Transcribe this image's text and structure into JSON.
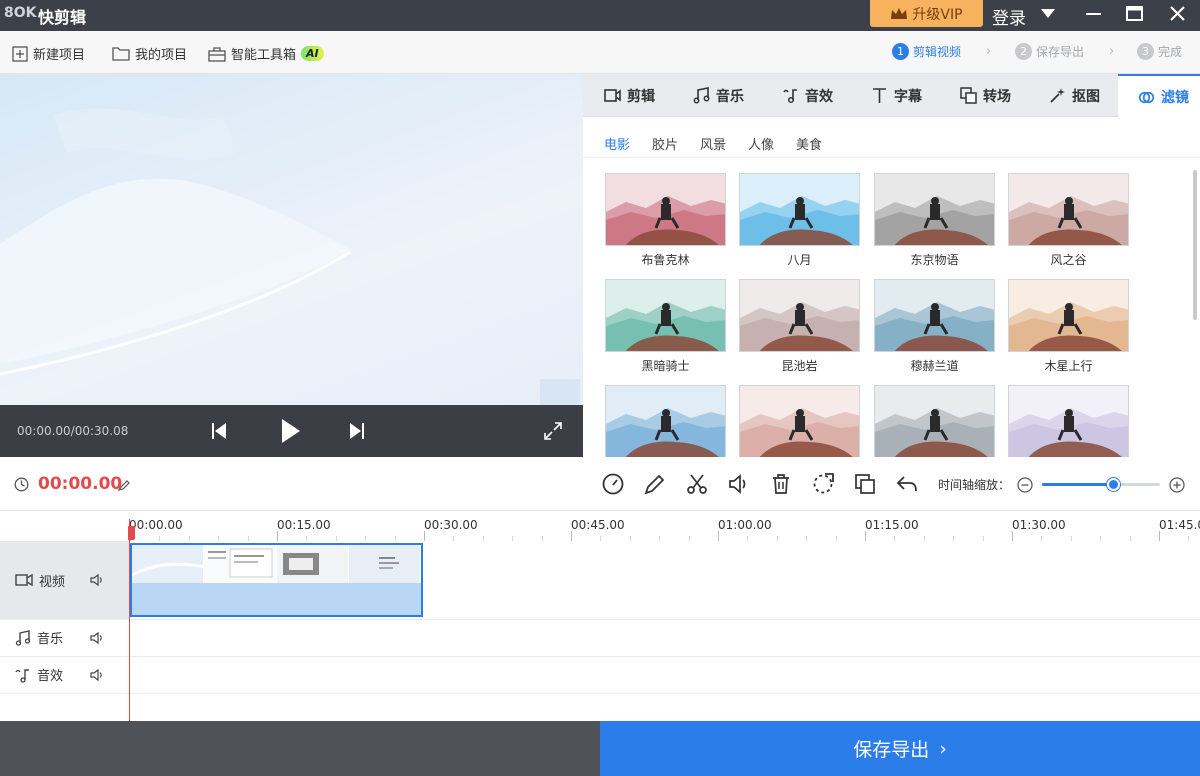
{
  "title_bar": {
    "logo": "8OK",
    "app_name": "快剪辑",
    "vip_label": "升级VIP",
    "login_label": "登录"
  },
  "toolbar": {
    "new_project": "新建项目",
    "my_projects": "我的项目",
    "smart_tools": "智能工具箱",
    "ai_badge": "AI"
  },
  "steps": [
    {
      "num": "1",
      "label": "剪辑视频",
      "active": true
    },
    {
      "num": "2",
      "label": "保存导出",
      "active": false
    },
    {
      "num": "3",
      "label": "完成",
      "active": false
    }
  ],
  "player": {
    "time_readout": "00:00.00/00:30.08"
  },
  "tabs": [
    {
      "label": "剪辑",
      "icon": "video-icon"
    },
    {
      "label": "音乐",
      "icon": "music-icon"
    },
    {
      "label": "音效",
      "icon": "sound-effect-icon"
    },
    {
      "label": "字幕",
      "icon": "text-icon"
    },
    {
      "label": "转场",
      "icon": "transition-icon"
    },
    {
      "label": "抠图",
      "icon": "magic-wand-icon"
    },
    {
      "label": "滤镜",
      "icon": "filter-icon",
      "active": true
    }
  ],
  "filter_categories": [
    {
      "label": "电影",
      "active": true
    },
    {
      "label": "胶片"
    },
    {
      "label": "风景"
    },
    {
      "label": "人像"
    },
    {
      "label": "美食"
    }
  ],
  "filters": [
    {
      "label": "布鲁克林",
      "tint": "#c96a7a"
    },
    {
      "label": "八月",
      "tint": "#5fb8e8"
    },
    {
      "label": "东京物语",
      "tint": "#9a9a9a"
    },
    {
      "label": "风之谷",
      "tint": "#c8a09a"
    },
    {
      "label": "黑暗骑士",
      "tint": "#6ab8a8"
    },
    {
      "label": "昆池岩",
      "tint": "#c0a8a8"
    },
    {
      "label": "穆赫兰道",
      "tint": "#7aa8c0"
    },
    {
      "label": "木星上行",
      "tint": "#e0b088"
    },
    {
      "label": "",
      "tint": "#7ab0d8"
    },
    {
      "label": "",
      "tint": "#d8a8a0"
    },
    {
      "label": "",
      "tint": "#a0a8b0"
    },
    {
      "label": "",
      "tint": "#c8c0e0"
    }
  ],
  "timeline": {
    "current_time": "00:00.00",
    "zoom_label": "时间轴缩放：",
    "zoom_level": 0.6,
    "ruler_labels": [
      "00:00.00",
      "00:15.00",
      "00:30.00",
      "00:45.00",
      "01:00.00",
      "01:15.00",
      "01:30.00",
      "01:45.00"
    ],
    "tracks": [
      {
        "label": "视频",
        "icon": "video-icon"
      },
      {
        "label": "音乐",
        "icon": "music-icon"
      },
      {
        "label": "音效",
        "icon": "sound-effect-icon"
      }
    ]
  },
  "export": {
    "label": "保存导出",
    "arrow": "›"
  },
  "colors": {
    "accent": "#2b7de9",
    "time_red": "#e24b4b",
    "vip": "#f6b25c"
  }
}
